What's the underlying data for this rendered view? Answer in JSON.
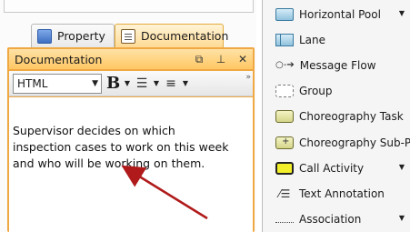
{
  "tabs": [
    {
      "label": "Property",
      "icon": "property-sheet-icon",
      "active": false
    },
    {
      "label": "Documentation",
      "icon": "document-icon",
      "active": true
    }
  ],
  "doc_panel": {
    "title": "Documentation",
    "controls": [
      "restore-icon",
      "pin-icon",
      "close-icon"
    ],
    "format_value": "HTML",
    "bold_label": "B",
    "text": "Supervisor decides on which\ninspection cases to work on this week\nand who will be working on them."
  },
  "palette": [
    {
      "label": "Horizontal Pool",
      "icon": "horizontal-pool-icon",
      "expandable": true
    },
    {
      "label": "Lane",
      "icon": "lane-icon",
      "expandable": false
    },
    {
      "label": "Message Flow",
      "icon": "message-flow-icon",
      "expandable": false
    },
    {
      "label": "Group",
      "icon": "group-icon",
      "expandable": false
    },
    {
      "label": "Choreography Task",
      "icon": "choreography-task-icon",
      "expandable": false
    },
    {
      "label": "Choreography Sub-Pr",
      "icon": "choreography-subprocess-icon",
      "expandable": false
    },
    {
      "label": "Call Activity",
      "icon": "call-activity-icon",
      "expandable": true
    },
    {
      "label": "Text Annotation",
      "icon": "text-annotation-icon",
      "expandable": false
    },
    {
      "label": "Association",
      "icon": "association-icon",
      "expandable": true
    }
  ],
  "colors": {
    "active_tab": "#ffdb95",
    "panel_border": "#f0a843",
    "annotation_arrow": "#b01a1a",
    "call_activity_fill": "#f2ef2a"
  }
}
